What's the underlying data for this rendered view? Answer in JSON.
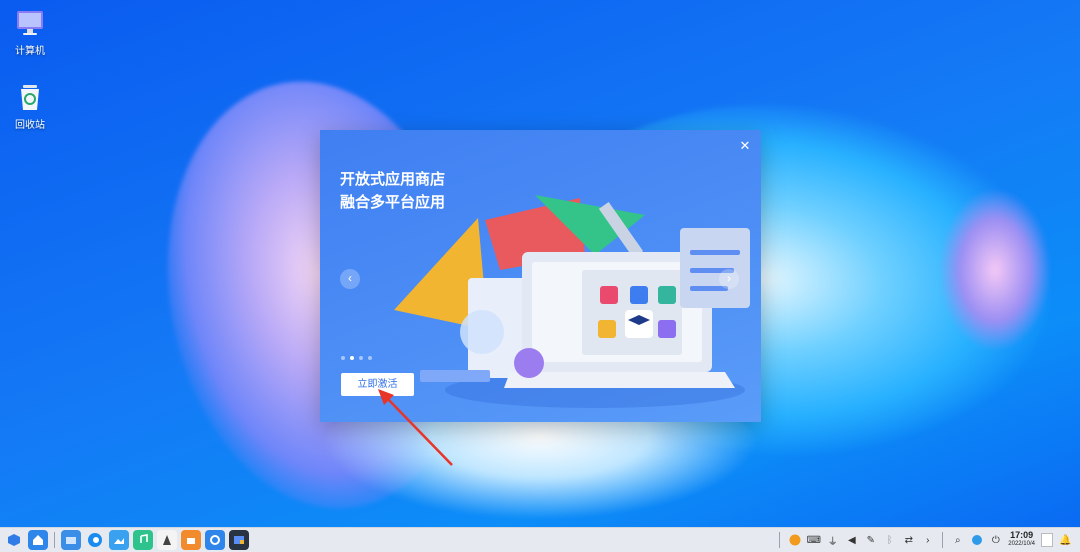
{
  "desktop": {
    "icons": [
      {
        "label": "计算机",
        "icon": "computer-icon"
      },
      {
        "label": "回收站",
        "icon": "recycle-bin-icon"
      }
    ]
  },
  "dialog": {
    "title_line1": "开放式应用商店",
    "title_line2": "融合多平台应用",
    "close_icon": "close-icon",
    "prev_icon": "chevron-left-icon",
    "next_icon": "chevron-right-icon",
    "carousel_active_index": 1,
    "carousel_count": 4,
    "activate_label": "立即激活"
  },
  "taskbar": {
    "apps": [
      "launcher-icon",
      "home-icon",
      "file-manager-icon",
      "browser-icon",
      "image-viewer-icon",
      "music-icon",
      "document-viewer-icon",
      "app-store-icon",
      "settings-icon",
      "activation-icon"
    ],
    "tray": [
      "security-icon",
      "keyboard-icon",
      "usb-icon",
      "volume-icon",
      "pen-icon",
      "bluetooth-icon",
      "transfer-icon",
      "expand-icon",
      "search-icon",
      "network-icon",
      "power-icon"
    ],
    "time": "17:09",
    "date": "2022/10/4"
  },
  "colors": {
    "accent": "#2f6fe8",
    "annotation_arrow": "#e8352a"
  }
}
